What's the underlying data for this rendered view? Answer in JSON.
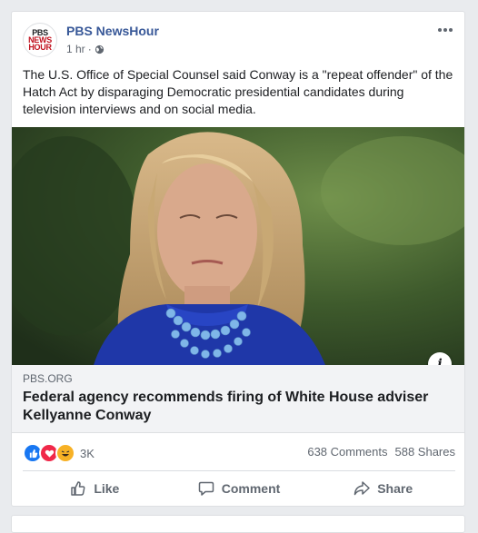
{
  "post": {
    "page_name": "PBS NewsHour",
    "logo": {
      "line1": "PBS",
      "line2": "NEWS",
      "line3": "HOUR"
    },
    "time": "1 hr",
    "separator": "·",
    "privacy_icon": "globe-icon",
    "body_text": "The U.S. Office of Special Counsel said Conway is a \"repeat offender\" of the Hatch Act by disparaging Democratic presidential candidates during television interviews and on social media."
  },
  "link": {
    "domain": "PBS.ORG",
    "title": "Federal agency recommends firing of White House adviser Kellyanne Conway",
    "info_icon": "i"
  },
  "stats": {
    "reaction_count": "3K",
    "comments": "638 Comments",
    "shares": "588 Shares",
    "reactions": [
      "like",
      "love",
      "haha"
    ]
  },
  "actions": {
    "like": "Like",
    "comment": "Comment",
    "share": "Share"
  },
  "colors": {
    "accent": "#385898",
    "like_blue": "#1877f2",
    "love_red": "#f02849",
    "haha_yellow": "#f7b125"
  }
}
